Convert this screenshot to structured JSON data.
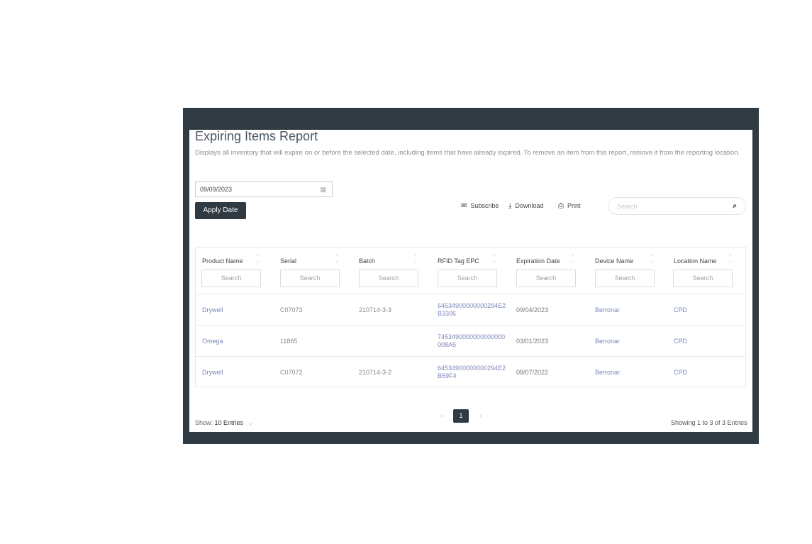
{
  "report": {
    "title": "Expiring Items Report",
    "description": "Displays all inventory that will expire on or before the selected date, including items that have already expired. To remove an item from this report, remove it from the reporting location."
  },
  "date_filter": {
    "value": "09/09/2023",
    "icon": "calendar-icon",
    "apply_label": "Apply Date"
  },
  "toolbar": {
    "subscribe_label": "Subscribe",
    "subscribe_icon": "envelope-icon",
    "download_label": "Download",
    "download_icon": "download-icon",
    "print_label": "Print",
    "print_icon": "printer-icon",
    "search_placeholder": "Search",
    "search_icon": "search-icon"
  },
  "table": {
    "columns": [
      {
        "label": "Product Name",
        "search": "Search"
      },
      {
        "label": "Serial",
        "search": "Search"
      },
      {
        "label": "Batch",
        "search": "Search"
      },
      {
        "label": "RFID Tag EPC",
        "search": "Search"
      },
      {
        "label": "Expiration Date",
        "search": "Search"
      },
      {
        "label": "Device Name",
        "search": "Search"
      },
      {
        "label": "Location Name",
        "search": "Search"
      }
    ],
    "rows": [
      {
        "product": "Drywell",
        "serial": "C07073",
        "batch": "210714-3-3",
        "epc_line1": "64534900000000294E2",
        "epc_line2": "B3306",
        "expiration": "09/04/2023",
        "device": "Berronar",
        "location": "CPD"
      },
      {
        "product": "Omega",
        "serial": "11865",
        "batch": "",
        "epc_line1": "7453490000000000000",
        "epc_line2": "008A5",
        "expiration": "03/01/2023",
        "device": "Berronar",
        "location": "CPD"
      },
      {
        "product": "Drywell",
        "serial": "C07072",
        "batch": "210714-3-2",
        "epc_line1": "64534900000000294E2",
        "epc_line2": "B59F4",
        "expiration": "08/07/2022",
        "device": "Berronar",
        "location": "CPD"
      }
    ]
  },
  "footer": {
    "show_label": "Show:",
    "entries_value": "10 Entries",
    "prev": "‹",
    "current_page": "1",
    "next": "›",
    "showing_text": "Showing 1 to 3 of 3 Entries"
  },
  "colors": {
    "frame": "#2f3a42",
    "link": "#7c86b8"
  }
}
